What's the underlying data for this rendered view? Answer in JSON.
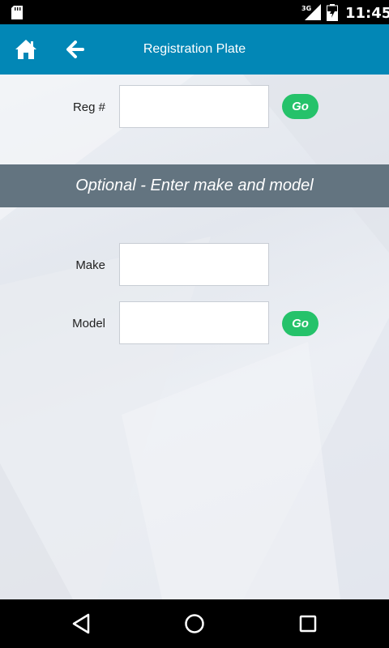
{
  "status_bar": {
    "network_label": "3G",
    "time": "11:45",
    "icons": [
      "sd-card-icon",
      "signal-icon",
      "battery-charging-icon"
    ]
  },
  "app_bar": {
    "title": "Registration Plate",
    "icons": [
      "home-icon",
      "back-arrow-icon"
    ],
    "background_color": "#0287b6"
  },
  "registration": {
    "label": "Reg #",
    "value": "",
    "go_label": "Go"
  },
  "optional_section": {
    "heading": "Optional - Enter make and model",
    "background_color": "#637480"
  },
  "make_model": {
    "make_label": "Make",
    "make_value": "",
    "model_label": "Model",
    "model_value": "",
    "go_label": "Go"
  },
  "accent_color": "#25c26a",
  "nav_bar": {
    "icons": [
      "back-triangle-icon",
      "home-circle-icon",
      "recents-square-icon"
    ]
  }
}
